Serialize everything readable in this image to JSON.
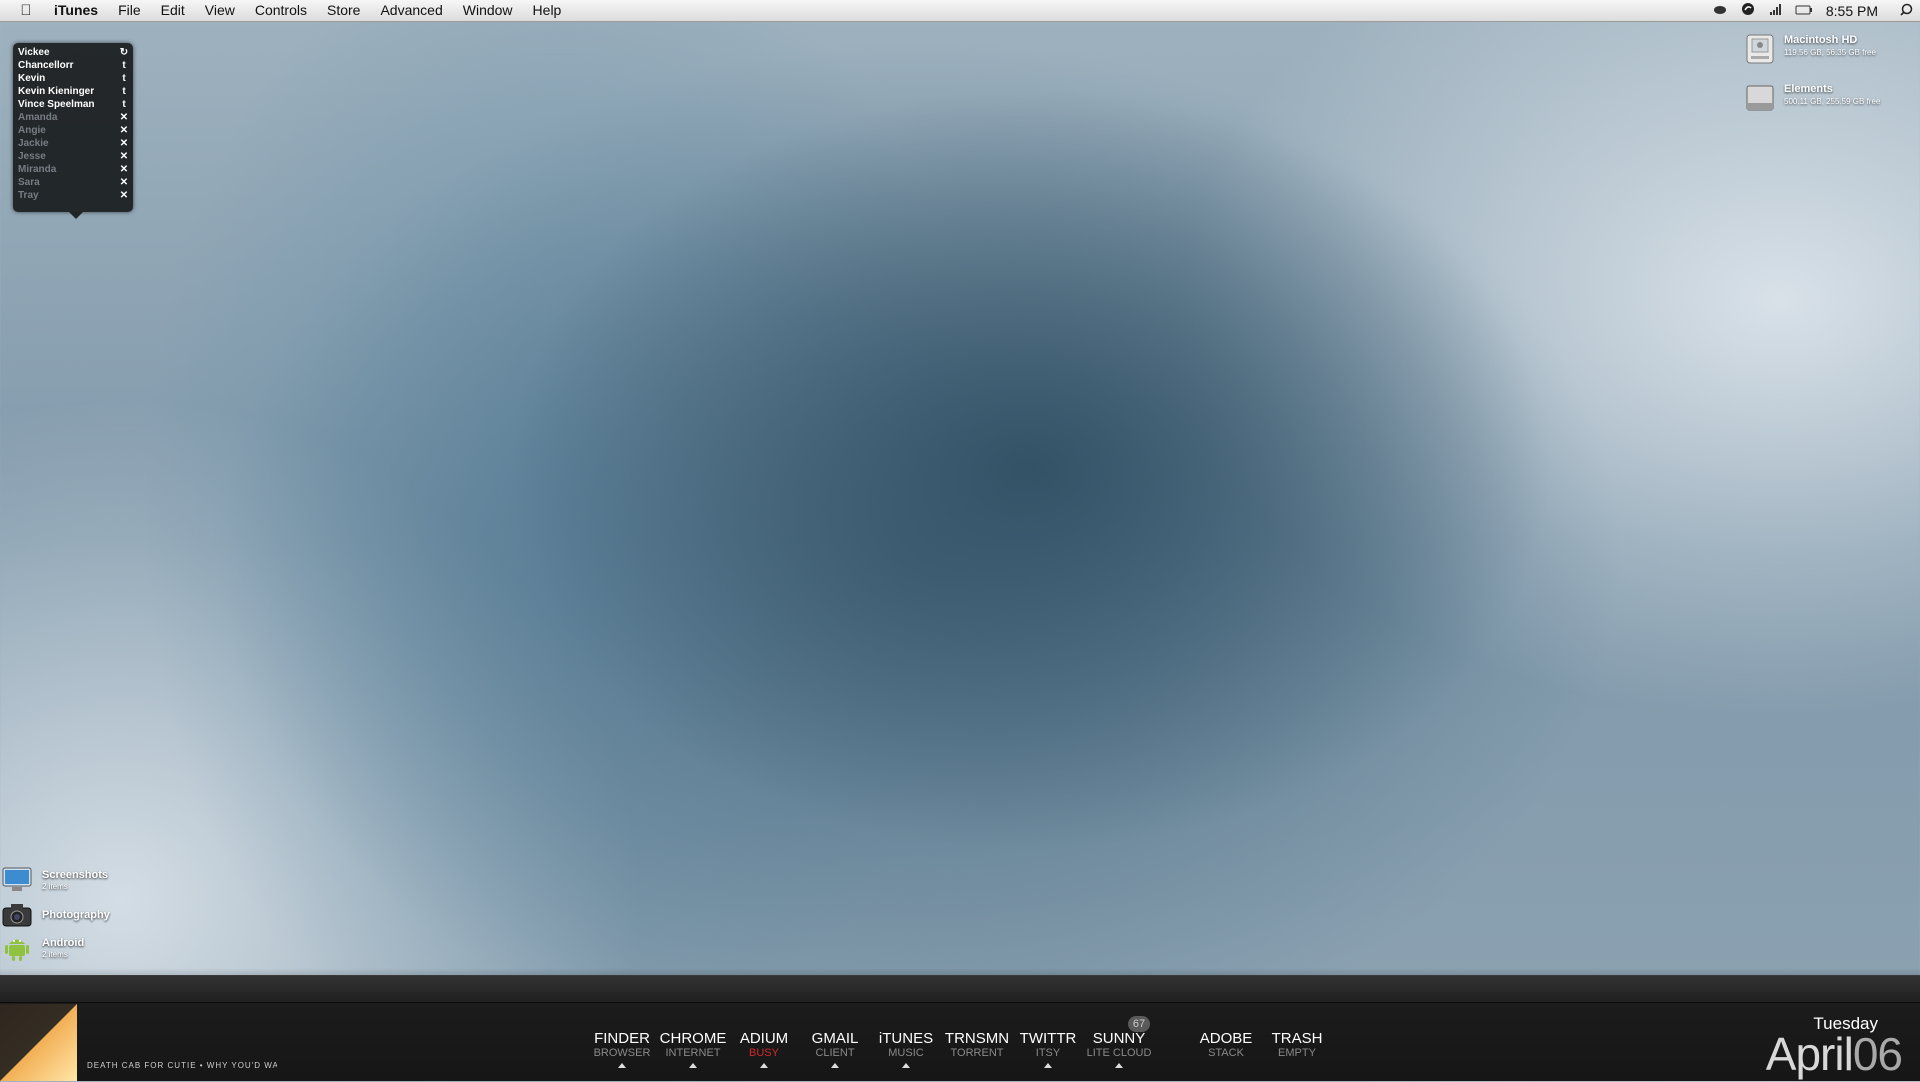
{
  "menubar": {
    "app_name": "iTunes",
    "items": [
      "File",
      "Edit",
      "View",
      "Controls",
      "Store",
      "Advanced",
      "Window",
      "Help"
    ],
    "clock": "8:55 PM"
  },
  "buddy_list": [
    {
      "name": "Vickee",
      "status": "refresh",
      "online": true
    },
    {
      "name": "Chancellorr",
      "status": "t",
      "online": true
    },
    {
      "name": "Kevin",
      "status": "t",
      "online": true
    },
    {
      "name": "Kevin Kieninger",
      "status": "t",
      "online": true
    },
    {
      "name": "Vince Speelman",
      "status": "t",
      "online": true
    },
    {
      "name": "Amanda",
      "status": "x",
      "online": false
    },
    {
      "name": "Angie",
      "status": "x",
      "online": false
    },
    {
      "name": "Jackie",
      "status": "x",
      "online": false
    },
    {
      "name": "Jesse",
      "status": "x",
      "online": false
    },
    {
      "name": "Miranda",
      "status": "x",
      "online": false
    },
    {
      "name": "Sara",
      "status": "x",
      "online": false
    },
    {
      "name": "Tray",
      "status": "x",
      "online": false
    }
  ],
  "drives": [
    {
      "name": "Macintosh HD",
      "info": "119.56 GB, 56.35 GB free"
    },
    {
      "name": "Elements",
      "info": "500.11 GB, 255.59 GB free"
    }
  ],
  "stacks": [
    {
      "name": "Screenshots",
      "info": "2 items"
    },
    {
      "name": "Photography",
      "info": ""
    },
    {
      "name": "Android",
      "info": "2 items"
    }
  ],
  "now_playing": "DEATH CAB FOR CUTIE • WHY YOU'D WA",
  "dock": [
    {
      "name": "FINDER",
      "sub": "BROWSER",
      "busy": false,
      "running": true
    },
    {
      "name": "CHROME",
      "sub": "INTERNET",
      "busy": false,
      "running": true
    },
    {
      "name": "ADIUM",
      "sub": "BUSY",
      "busy": true,
      "running": true
    },
    {
      "name": "GMAIL",
      "sub": "CLIENT",
      "busy": false,
      "running": true
    },
    {
      "name": "iTUNES",
      "sub": "MUSIC",
      "busy": false,
      "running": true
    },
    {
      "name": "TRNSMN",
      "sub": "TORRENT",
      "busy": false,
      "running": false
    },
    {
      "name": "TWITTR",
      "sub": "ITSY",
      "busy": false,
      "running": true
    },
    {
      "name": "SUNNY",
      "sub": "LITE CLOUD",
      "busy": false,
      "running": true
    },
    {
      "name": "ADOBE",
      "sub": "STACK",
      "busy": false,
      "running": false
    },
    {
      "name": "TRASH",
      "sub": "EMPTY",
      "busy": false,
      "running": false
    }
  ],
  "weather_badge": "67",
  "date": {
    "weekday": "Tuesday",
    "month": "April",
    "day": "06"
  }
}
